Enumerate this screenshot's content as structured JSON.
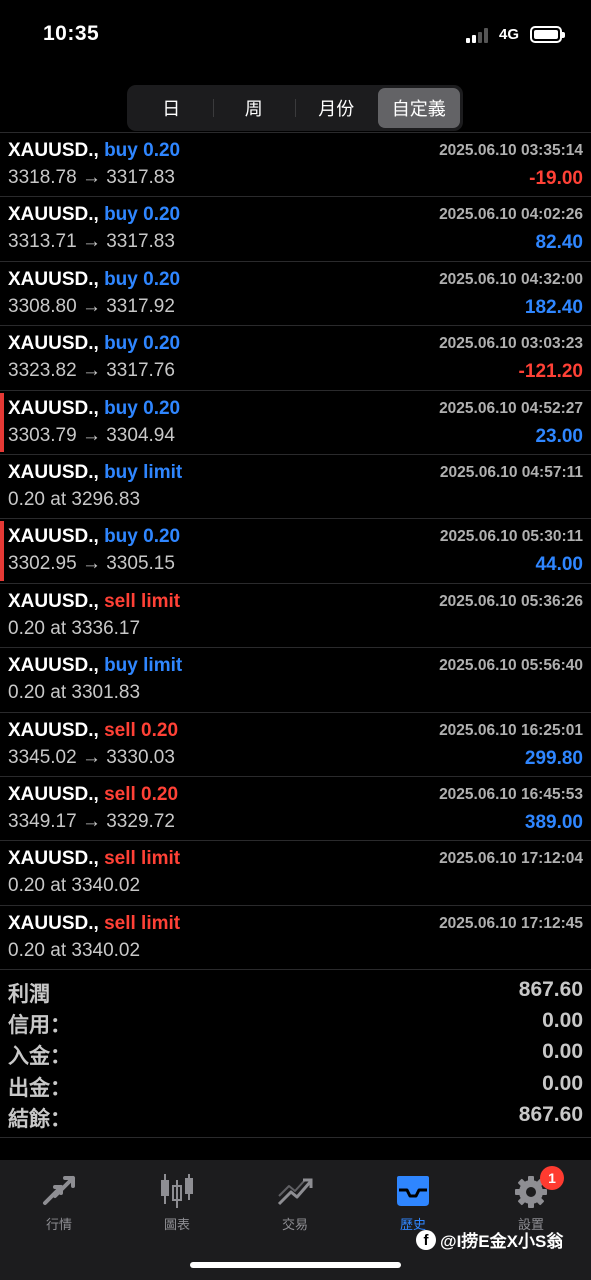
{
  "status_bar": {
    "time": "10:35",
    "network": "4G"
  },
  "period_tabs": [
    {
      "label": "日",
      "active": false
    },
    {
      "label": "周",
      "active": false
    },
    {
      "label": "月份",
      "active": false
    },
    {
      "label": "自定義",
      "active": true
    }
  ],
  "orders": [
    {
      "symbol": "XAUUSD.,",
      "action": "buy 0.20",
      "side": "buy",
      "time": "2025.06.10 03:35:14",
      "detail": "3318.78 → 3317.83",
      "profit": "-19.00",
      "profit_sign": "neg",
      "marked": false
    },
    {
      "symbol": "XAUUSD.,",
      "action": "buy 0.20",
      "side": "buy",
      "time": "2025.06.10 04:02:26",
      "detail": "3313.71 → 3317.83",
      "profit": "82.40",
      "profit_sign": "pos",
      "marked": false
    },
    {
      "symbol": "XAUUSD.,",
      "action": "buy 0.20",
      "side": "buy",
      "time": "2025.06.10 04:32:00",
      "detail": "3308.80 → 3317.92",
      "profit": "182.40",
      "profit_sign": "pos",
      "marked": false
    },
    {
      "symbol": "XAUUSD.,",
      "action": "buy 0.20",
      "side": "buy",
      "time": "2025.06.10 03:03:23",
      "detail": "3323.82 → 3317.76",
      "profit": "-121.20",
      "profit_sign": "neg",
      "marked": false
    },
    {
      "symbol": "XAUUSD.,",
      "action": "buy 0.20",
      "side": "buy",
      "time": "2025.06.10 04:52:27",
      "detail": "3303.79 → 3304.94",
      "profit": "23.00",
      "profit_sign": "pos",
      "marked": true
    },
    {
      "symbol": "XAUUSD.,",
      "action": "buy limit",
      "side": "buy",
      "time": "2025.06.10 04:57:11",
      "detail": "0.20 at 3296.83",
      "profit": "",
      "profit_sign": "",
      "marked": false
    },
    {
      "symbol": "XAUUSD.,",
      "action": "buy 0.20",
      "side": "buy",
      "time": "2025.06.10 05:30:11",
      "detail": "3302.95 → 3305.15",
      "profit": "44.00",
      "profit_sign": "pos",
      "marked": true
    },
    {
      "symbol": "XAUUSD.,",
      "action": "sell limit",
      "side": "sell",
      "time": "2025.06.10 05:36:26",
      "detail": "0.20 at 3336.17",
      "profit": "",
      "profit_sign": "",
      "marked": false
    },
    {
      "symbol": "XAUUSD.,",
      "action": "buy limit",
      "side": "buy",
      "time": "2025.06.10 05:56:40",
      "detail": "0.20 at 3301.83",
      "profit": "",
      "profit_sign": "",
      "marked": false
    },
    {
      "symbol": "XAUUSD.,",
      "action": "sell 0.20",
      "side": "sell",
      "time": "2025.06.10 16:25:01",
      "detail": "3345.02 → 3330.03",
      "profit": "299.80",
      "profit_sign": "pos",
      "marked": false
    },
    {
      "symbol": "XAUUSD.,",
      "action": "sell 0.20",
      "side": "sell",
      "time": "2025.06.10 16:45:53",
      "detail": "3349.17 → 3329.72",
      "profit": "389.00",
      "profit_sign": "pos",
      "marked": false
    },
    {
      "symbol": "XAUUSD.,",
      "action": "sell limit",
      "side": "sell",
      "time": "2025.06.10 17:12:04",
      "detail": "0.20 at 3340.02",
      "profit": "",
      "profit_sign": "",
      "marked": false
    },
    {
      "symbol": "XAUUSD.,",
      "action": "sell limit",
      "side": "sell",
      "time": "2025.06.10 17:12:45",
      "detail": "0.20 at 3340.02",
      "profit": "",
      "profit_sign": "",
      "marked": false
    }
  ],
  "summary": [
    {
      "label": "利潤",
      "value": "867.60"
    },
    {
      "label": "信用：",
      "value": "0.00"
    },
    {
      "label": "入金：",
      "value": "0.00"
    },
    {
      "label": "出金：",
      "value": "0.00"
    },
    {
      "label": "結餘：",
      "value": "867.60"
    }
  ],
  "tab_bar": [
    {
      "label": "行情",
      "icon": "quotes-arrows-icon",
      "active": false
    },
    {
      "label": "圖表",
      "icon": "candlestick-chart-icon",
      "active": false
    },
    {
      "label": "交易",
      "icon": "trade-trend-icon",
      "active": false
    },
    {
      "label": "歷史",
      "icon": "history-tray-icon",
      "active": true
    },
    {
      "label": "設置",
      "icon": "gear-icon",
      "active": false,
      "badge": "1"
    }
  ],
  "watermark": "@I捞E金X小S翁",
  "colors": {
    "buy": "#2f86ff",
    "sell": "#ff4136",
    "marker": "#e53935",
    "active_tab": "#2f86ff"
  }
}
